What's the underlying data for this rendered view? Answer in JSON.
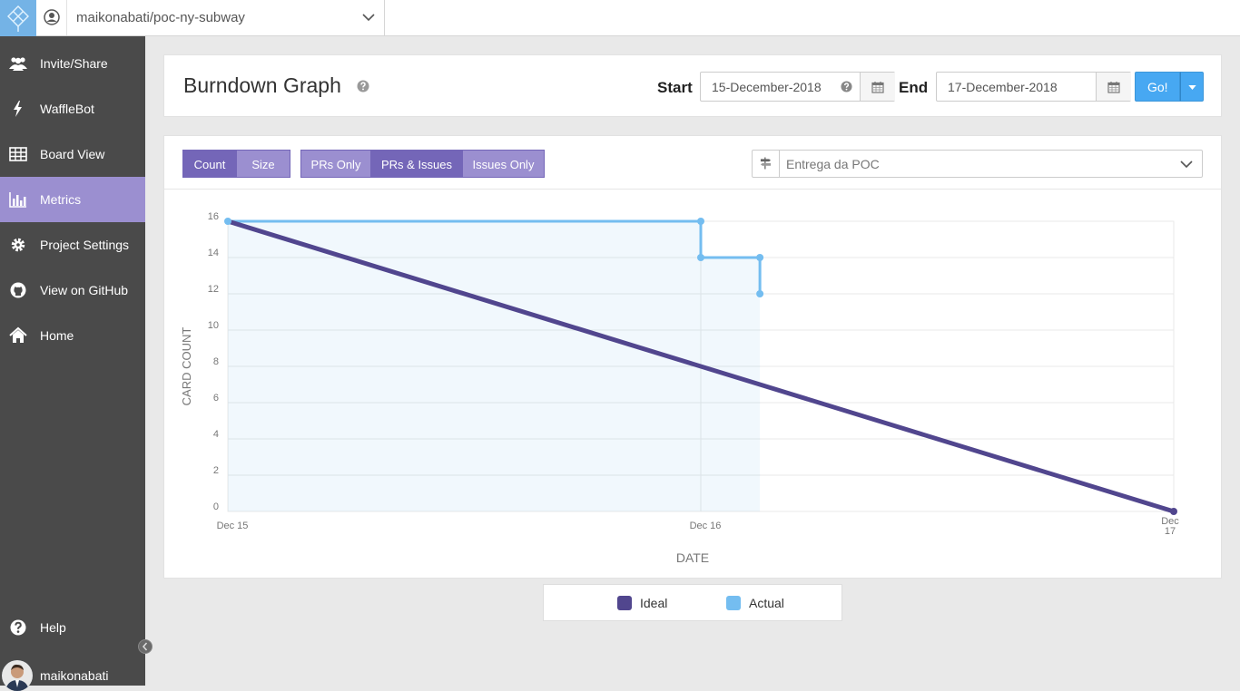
{
  "topbar": {
    "repo_name": "maikonabati/poc-ny-subway"
  },
  "sidebar": {
    "items": [
      {
        "label": "Invite/Share",
        "icon": "users-icon"
      },
      {
        "label": "WaffleBot",
        "icon": "bolt-icon"
      },
      {
        "label": "Board View",
        "icon": "grid-icon"
      },
      {
        "label": "Metrics",
        "icon": "bar-chart-icon",
        "active": true
      },
      {
        "label": "Project Settings",
        "icon": "gear-icon"
      },
      {
        "label": "View on GitHub",
        "icon": "github-icon"
      },
      {
        "label": "Home",
        "icon": "home-icon"
      }
    ],
    "help_label": "Help",
    "user_name": "maikonabati"
  },
  "header": {
    "title": "Burndown Graph",
    "start_label": "Start",
    "start_date": "15-December-2018",
    "end_label": "End",
    "end_date": "17-December-2018",
    "go_label": "Go!"
  },
  "toolbar": {
    "count_label": "Count",
    "size_label": "Size",
    "prs_only_label": "PRs Only",
    "prs_issues_label": "PRs & Issues",
    "issues_only_label": "Issues Only",
    "milestone": "Entrega da POC"
  },
  "colors": {
    "ideal": "#51468e",
    "actual": "#74bdf0",
    "accent": "#9b8fd0",
    "go": "#47a8f2"
  },
  "chart_data": {
    "type": "line",
    "xlabel": "DATE",
    "ylabel": "CARD COUNT",
    "ylim": [
      0,
      16
    ],
    "yticks": [
      0,
      2,
      4,
      6,
      8,
      10,
      12,
      14,
      16
    ],
    "xticks": [
      {
        "day": 15,
        "label": "Dec 15"
      },
      {
        "day": 16,
        "label": "Dec 16"
      },
      {
        "day": 17,
        "label": "Dec 17"
      }
    ],
    "series": [
      {
        "name": "Ideal",
        "points": [
          [
            15,
            16
          ],
          [
            17,
            0
          ]
        ]
      },
      {
        "name": "Actual",
        "points": [
          [
            15,
            16
          ],
          [
            16,
            16
          ],
          [
            16,
            14
          ],
          [
            16.125,
            14
          ],
          [
            16.125,
            12
          ]
        ]
      }
    ],
    "legend": "bottom"
  }
}
